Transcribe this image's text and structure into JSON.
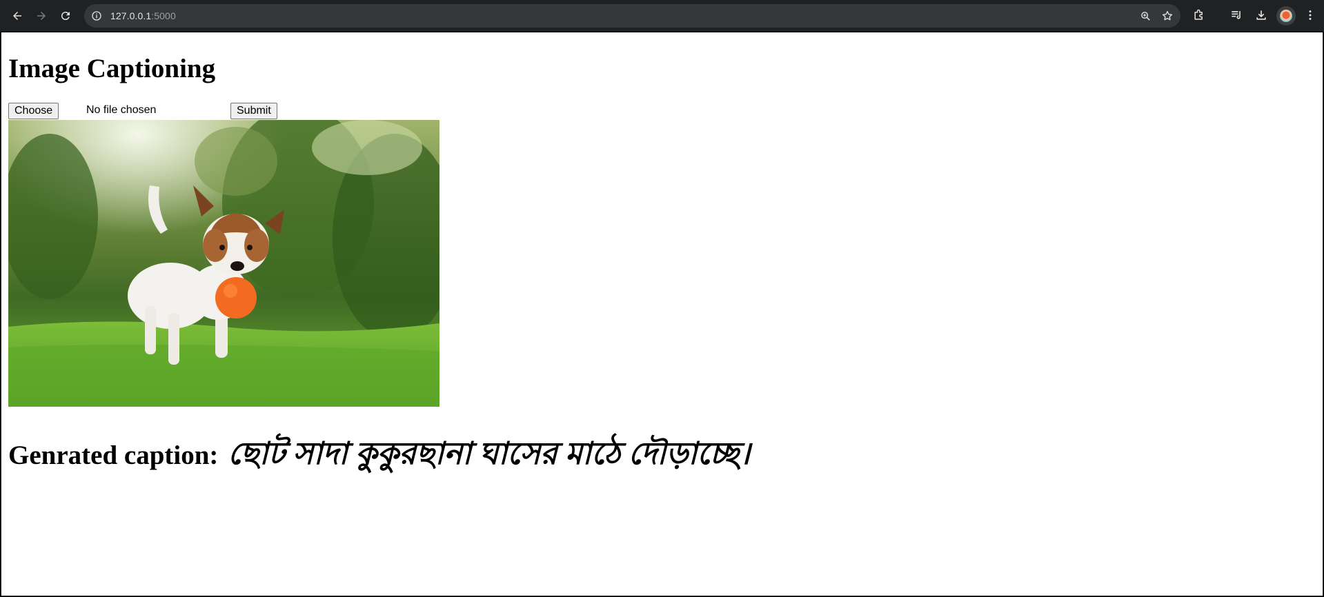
{
  "browser": {
    "url_host": "127.0.0.1",
    "url_port": ":5000",
    "nav": {
      "back_icon": "arrow-left-icon",
      "forward_icon": "arrow-right-icon",
      "reload_icon": "reload-icon"
    },
    "toolbar_icons": [
      "zoom-icon",
      "bookmark-star-icon",
      "extensions-icon",
      "media-queue-icon",
      "download-icon",
      "profile-avatar",
      "more-menu-icon"
    ]
  },
  "page": {
    "title": "Image Captioning",
    "form": {
      "choose_file_label": "Choose File",
      "file_status": "No file chosen",
      "submit_label": "Submit"
    },
    "image": {
      "subject_icon": "dog-photo"
    },
    "caption": {
      "label": "Genrated caption:",
      "text": "ছোট সাদা কুকুরছানা ঘাসের মাঠে দৌড়াচ্ছে।"
    }
  },
  "colors": {
    "chrome_bg": "#1f2123",
    "omnibox_bg": "#35373b",
    "page_bg": "#ffffff",
    "button_bg": "#efefef"
  }
}
